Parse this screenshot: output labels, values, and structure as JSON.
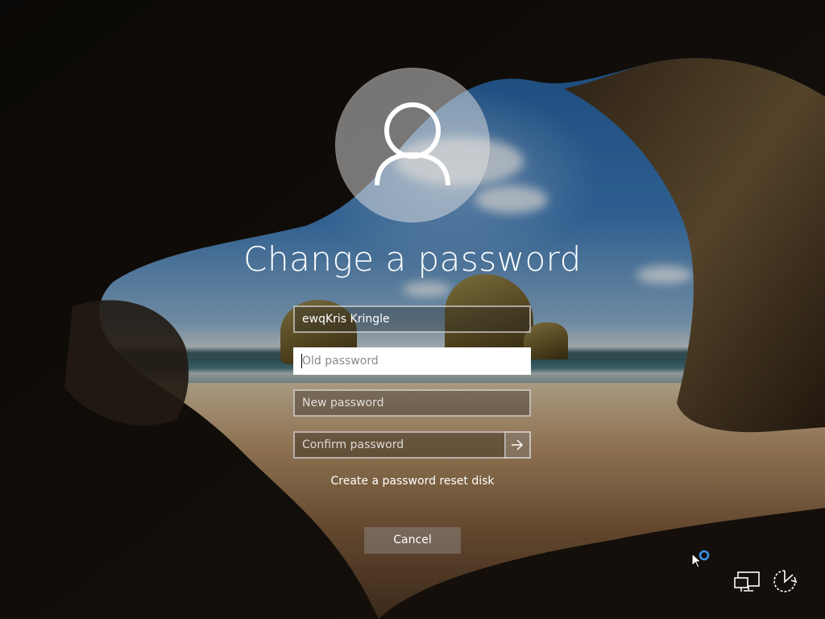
{
  "screen": {
    "title": "Change a password"
  },
  "form": {
    "username": "ewqKris Kringle",
    "old_password_placeholder": "Old password",
    "new_password_placeholder": "New password",
    "confirm_password_placeholder": "Confirm password",
    "submit_icon": "arrow-right-icon",
    "reset_disk_link": "Create a password reset disk",
    "cancel_label": "Cancel"
  },
  "icons": {
    "avatar": "user-icon",
    "network": "network-icon",
    "ease_of_access": "ease-of-access-icon",
    "cursor": "pointer-busy-icon"
  },
  "colors": {
    "text": "#ffffff",
    "focused_field_bg": "#ffffff",
    "busy_indicator": "#3a8fe8"
  }
}
